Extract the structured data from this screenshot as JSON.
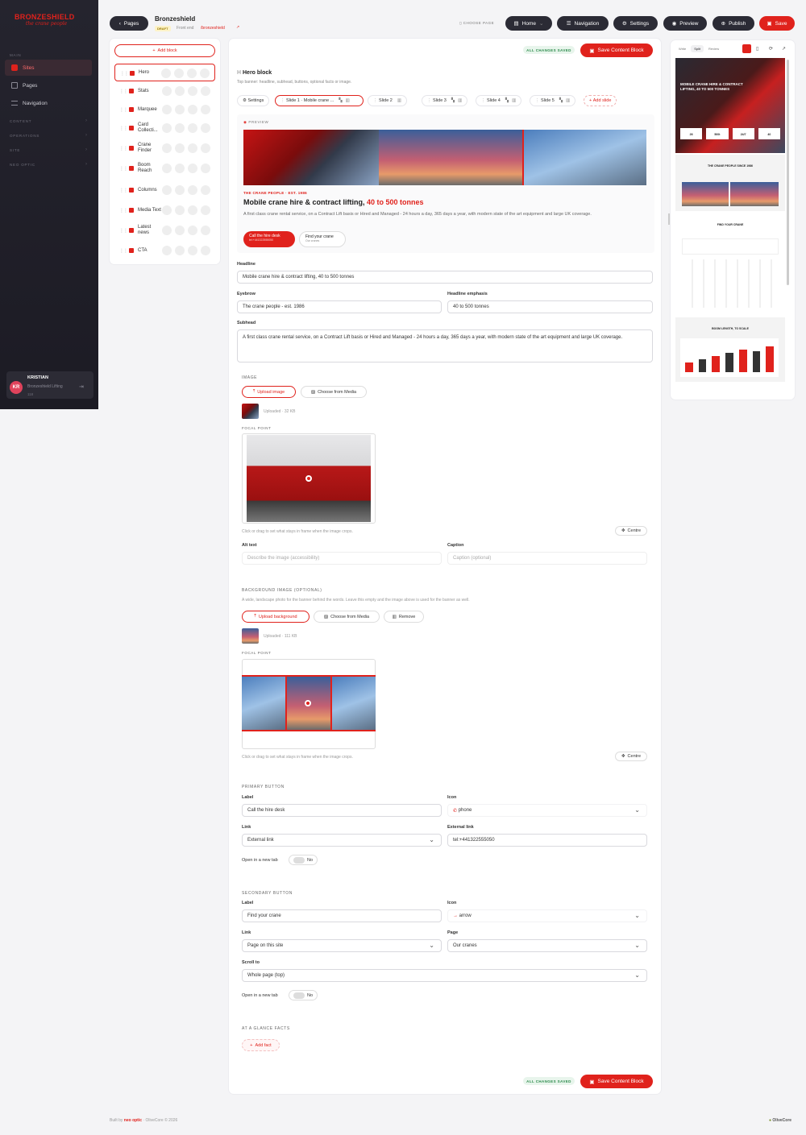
{
  "brand": {
    "name": "BRONZESHIELD",
    "tagline": "the crane people"
  },
  "sidebar": {
    "sections": [
      "MAIN",
      "CONTENT",
      "OPERATIONS",
      "SITE",
      "NEO OPTIC"
    ],
    "items": [
      {
        "label": "Sites",
        "active": true
      },
      {
        "label": "Pages"
      },
      {
        "label": "Navigation"
      }
    ],
    "user": {
      "initials": "KR",
      "name": "KRISTIAN",
      "company": "Bronzeshield Lifting",
      "role": "118"
    }
  },
  "topbar": {
    "back_label": "Pages",
    "site_title": "Bronzeshield",
    "status": "DRAFT",
    "frontend_label": "Front end",
    "frontend_link": "/bronzeshield",
    "choose_page": "CHOOSE PAGE",
    "page_select": "Home",
    "navigation": "Navigation",
    "settings": "Settings",
    "preview": "Preview",
    "publish": "Publish",
    "save": "Save"
  },
  "blocks": {
    "add_label": "Add block",
    "items": [
      {
        "label": "Hero",
        "active": true
      },
      {
        "label": "Stats"
      },
      {
        "label": "Marquee"
      },
      {
        "label": "Card Collecti..."
      },
      {
        "label": "Crane Finder"
      },
      {
        "label": "Boom Reach"
      },
      {
        "label": "Columns"
      },
      {
        "label": "Media Text"
      },
      {
        "label": "Latest news"
      },
      {
        "label": "CTA"
      }
    ]
  },
  "editor": {
    "saved_badge": "ALL CHANGES SAVED",
    "save_block": "Save Content Block",
    "title": "Hero block",
    "description": "Top banner: headline, subhead, buttons, optional facts or image.",
    "tabs": [
      "Settings",
      "Slide 1 · Mobile crane ...",
      "Slide 2",
      "Slide 3",
      "Slide 4",
      "Slide 5"
    ],
    "add_slide": "Add slide",
    "preview_label": "PREVIEW",
    "preview": {
      "eyebrow": "THE CRANE PEOPLE · EST. 1986",
      "headline": "Mobile crane hire & contract lifting, ",
      "emphasis": "40 to 500 tonnes",
      "subhead": "A first class crane rental service, on a Contract Lift basis or Hired and Managed - 24 hours a day, 365 days a year, with modern state of the art equipment and large UK coverage.",
      "btn1": "Call the hire desk",
      "btn1_sub": "tel:+441322555050",
      "btn2": "Find your crane",
      "btn2_sub": "Our cranes"
    },
    "fields": {
      "headline_label": "Headline",
      "headline": "Mobile crane hire & contract lifting, 40 to 500 tonnes",
      "eyebrow_label": "Eyebrow",
      "eyebrow": "The crane people - est. 1986",
      "emphasis_label": "Headline emphasis",
      "emphasis": "40 to 500 tonnes",
      "subhead_label": "Subhead",
      "subhead": "A first class crane rental service, on a Contract Lift basis or Hired and Managed - 24 hours a day, 365 days a year, with modern state of the art equipment and large UK coverage."
    },
    "image": {
      "section": "IMAGE",
      "upload": "Upload image",
      "choose": "Choose from Media",
      "uploaded": "Uploaded · 32 KB",
      "focal": "FOCAL POINT",
      "hint": "Click or drag to set what stays in frame when the image crops.",
      "centre": "Centre",
      "alt_label": "Alt text",
      "alt_ph": "Describe the image (accessibility)",
      "caption_label": "Caption",
      "caption_ph": "Caption (optional)"
    },
    "background": {
      "section": "BACKGROUND IMAGE (OPTIONAL)",
      "desc": "A wide, landscape photo for the banner behind the words. Leave this empty and the image above is used for the banner as well.",
      "upload": "Upload background",
      "choose": "Choose from Media",
      "remove": "Remove",
      "uploaded": "Uploaded · 111 KB",
      "focal": "FOCAL POINT",
      "hint": "Click or drag to set what stays in frame when the image crops.",
      "centre": "Centre"
    },
    "primary": {
      "section": "PRIMARY BUTTON",
      "label_label": "Label",
      "label": "Call the hire desk",
      "icon_label": "Icon",
      "icon": "phone",
      "link_label": "Link",
      "link": "External link",
      "ext_label": "External link",
      "ext": "tel:+441322555050",
      "newtab": "Open in a new tab",
      "no": "No"
    },
    "secondary": {
      "section": "SECONDARY BUTTON",
      "label_label": "Label",
      "label": "Find your crane",
      "icon_label": "Icon",
      "icon": "arrow",
      "link_label": "Link",
      "link": "Page on this site",
      "page_label": "Page",
      "page": "Our cranes",
      "scroll_label": "Scroll to",
      "scroll": "Whole page (top)",
      "newtab": "Open in a new tab",
      "no": "No"
    },
    "facts": {
      "section": "AT A GLANCE FACTS",
      "add": "Add fact"
    }
  },
  "rightpanel": {
    "modes": [
      "Write",
      "Split",
      "Review"
    ],
    "hero_title": "MOBILE CRANE HIRE & CONTRACT LIFTING, 40 TO 500 TONNES",
    "stats": [
      "26",
      "500t",
      "24/7",
      "40"
    ],
    "sec1": "THE CRANE PEOPLE SINCE 1986",
    "sec2": "FIND YOUR CRANE",
    "sec3": "BOOM LENGTH, TO SCALE"
  },
  "footer": {
    "built_by": "Built by",
    "agency": "neo optic",
    "product": "OliveCore © 2026",
    "right": "OliveCore"
  },
  "colors": {
    "accent": "#e0221c",
    "dark": "#2b2b35"
  }
}
